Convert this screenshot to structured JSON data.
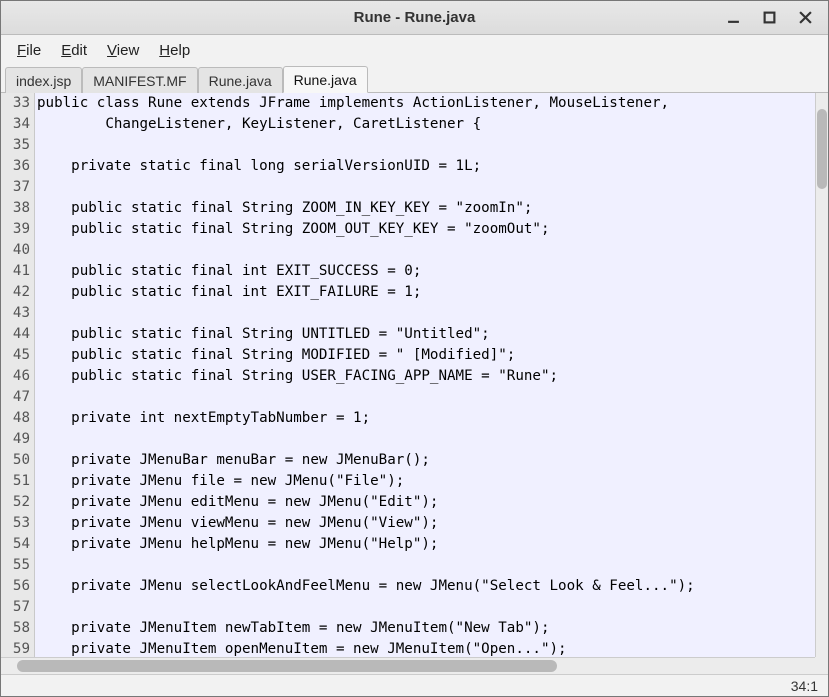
{
  "window": {
    "title": "Rune - Rune.java"
  },
  "menubar": {
    "file": "File",
    "edit": "Edit",
    "view": "View",
    "help": "Help"
  },
  "tabs": [
    {
      "label": "index.jsp",
      "active": false
    },
    {
      "label": "MANIFEST.MF",
      "active": false
    },
    {
      "label": "Rune.java",
      "active": false
    },
    {
      "label": "Rune.java",
      "active": true
    }
  ],
  "gutter_start": 33,
  "code_lines": [
    "public class Rune extends JFrame implements ActionListener, MouseListener,",
    "        ChangeListener, KeyListener, CaretListener {",
    "",
    "    private static final long serialVersionUID = 1L;",
    "",
    "    public static final String ZOOM_IN_KEY_KEY = \"zoomIn\";",
    "    public static final String ZOOM_OUT_KEY_KEY = \"zoomOut\";",
    "",
    "    public static final int EXIT_SUCCESS = 0;",
    "    public static final int EXIT_FAILURE = 1;",
    "",
    "    public static final String UNTITLED = \"Untitled\";",
    "    public static final String MODIFIED = \" [Modified]\";",
    "    public static final String USER_FACING_APP_NAME = \"Rune\";",
    "",
    "    private int nextEmptyTabNumber = 1;",
    "",
    "    private JMenuBar menuBar = new JMenuBar();",
    "    private JMenu file = new JMenu(\"File\");",
    "    private JMenu editMenu = new JMenu(\"Edit\");",
    "    private JMenu viewMenu = new JMenu(\"View\");",
    "    private JMenu helpMenu = new JMenu(\"Help\");",
    "",
    "    private JMenu selectLookAndFeelMenu = new JMenu(\"Select Look & Feel...\");",
    "",
    "    private JMenuItem newTabItem = new JMenuItem(\"New Tab\");",
    "    private JMenuItem openMenuItem = new JMenuItem(\"Open...\");"
  ],
  "status": {
    "cursor": "34:1"
  }
}
